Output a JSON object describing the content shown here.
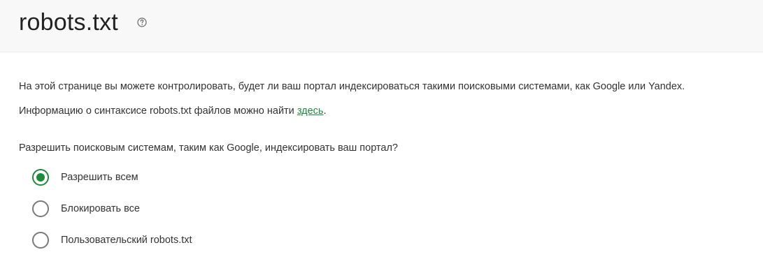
{
  "header": {
    "title": "robots.txt"
  },
  "intro": {
    "line1": "На этой странице вы можете контролировать, будет ли ваш портал индексироваться такими поисковыми системами, как Google или Yandex.",
    "line2_prefix": "Информацию о синтаксисе robots.txt файлов можно найти ",
    "line2_link": "здесь",
    "line2_suffix": "."
  },
  "question": "Разрешить поисковым системам, таким как Google, индексировать ваш портал?",
  "options": [
    {
      "label": "Разрешить всем",
      "selected": true
    },
    {
      "label": "Блокировать все",
      "selected": false
    },
    {
      "label": "Пользовательский robots.txt",
      "selected": false
    }
  ],
  "colors": {
    "accent": "#1f8a3c",
    "header_bg": "#f8f8f8"
  }
}
